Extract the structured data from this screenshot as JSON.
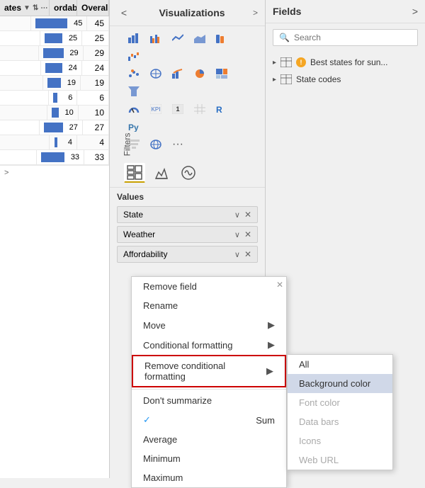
{
  "leftPanel": {
    "headers": {
      "states": "ates",
      "affordability": "ordability",
      "overall": "Overal"
    },
    "rows": [
      {
        "state": "",
        "bar": 45,
        "overall": 45
      },
      {
        "state": "",
        "bar": 25,
        "overall": 25
      },
      {
        "state": "",
        "bar": 29,
        "overall": 29
      },
      {
        "state": "",
        "bar": 24,
        "overall": 24
      },
      {
        "state": "",
        "bar": 19,
        "overall": 19
      },
      {
        "state": "",
        "bar": 6,
        "overall": 6
      },
      {
        "state": "",
        "bar": 10,
        "overall": 10
      },
      {
        "state": "",
        "bar": 27,
        "overall": 27
      },
      {
        "state": "",
        "bar": 4,
        "overall": 4
      },
      {
        "state": "",
        "bar": 33,
        "overall": 33
      }
    ],
    "moreIndicator": ">"
  },
  "visualizationsPanel": {
    "title": "Visualizations",
    "collapseButton": "<",
    "expandButton": ">",
    "filtersLabel": "Filters",
    "tabs": {
      "buildTab": "build",
      "formatTab": "format",
      "analyticsTab": "analytics"
    },
    "values": {
      "label": "Values",
      "fields": [
        {
          "name": "State",
          "canExpand": true,
          "hasClose": true
        },
        {
          "name": "Weather",
          "canExpand": true,
          "hasClose": true
        },
        {
          "name": "Affordability",
          "canExpand": true,
          "hasClose": true
        }
      ]
    }
  },
  "fieldsPanel": {
    "title": "Fields",
    "expandButton": ">",
    "search": {
      "placeholder": "Search",
      "icon": "🔍"
    },
    "groups": [
      {
        "name": "Best states for sun...",
        "hasWarning": true,
        "items": []
      },
      {
        "name": "State codes",
        "hasWarning": false,
        "items": []
      }
    ]
  },
  "contextMenu": {
    "items": [
      {
        "label": "Remove field",
        "hasArrow": false,
        "hasCheck": false
      },
      {
        "label": "Rename",
        "hasArrow": false,
        "hasCheck": false
      },
      {
        "label": "Move",
        "hasArrow": true,
        "hasCheck": false
      },
      {
        "label": "Conditional formatting",
        "hasArrow": true,
        "hasCheck": false
      },
      {
        "label": "Remove conditional formatting",
        "hasArrow": true,
        "hasCheck": false,
        "highlighted": true
      },
      {
        "label": "Don't summarize",
        "hasArrow": false,
        "hasCheck": false
      },
      {
        "label": "Sum",
        "hasArrow": false,
        "hasCheck": true
      },
      {
        "label": "Average",
        "hasArrow": false,
        "hasCheck": false
      },
      {
        "label": "Minimum",
        "hasArrow": false,
        "hasCheck": false
      },
      {
        "label": "Maximum",
        "hasArrow": false,
        "hasCheck": false
      }
    ]
  },
  "submenu": {
    "items": [
      {
        "label": "All",
        "selected": false,
        "disabled": false
      },
      {
        "label": "Background color",
        "selected": true,
        "disabled": false
      },
      {
        "label": "Font color",
        "selected": false,
        "disabled": true
      },
      {
        "label": "Data bars",
        "selected": false,
        "disabled": true
      },
      {
        "label": "Icons",
        "selected": false,
        "disabled": true
      },
      {
        "label": "Web URL",
        "selected": false,
        "disabled": true
      }
    ]
  }
}
